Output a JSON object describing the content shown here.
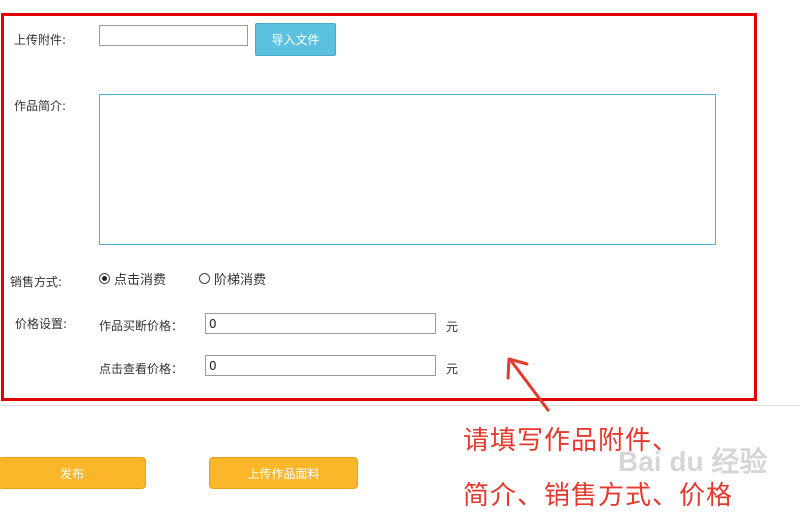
{
  "form": {
    "upload_label": "上传附件:",
    "import_button": "导入文件",
    "description_label": "作品简介:",
    "sales_mode_label": "销售方式:",
    "sales_options": [
      {
        "label": "点击消费",
        "selected": true
      },
      {
        "label": "阶梯消费",
        "selected": false
      }
    ],
    "price_settings_label": "价格设置:",
    "buyout_price_label": "作品买断价格：",
    "buyout_price_value": "0",
    "view_price_label": "点击查看价格：",
    "view_price_value": "0",
    "currency_unit": "元"
  },
  "actions": {
    "publish_button": "发布",
    "upload_material_button": "上传作品面料"
  },
  "annotation": {
    "line1": "请填写作品附件、",
    "line2": "简介、销售方式、价格"
  },
  "watermark": "Bai du 经验",
  "colors": {
    "highlight_border": "#e00000",
    "import_button": "#5cc1df",
    "action_button": "#fcb62a",
    "annotation_text": "#e43a2e"
  }
}
